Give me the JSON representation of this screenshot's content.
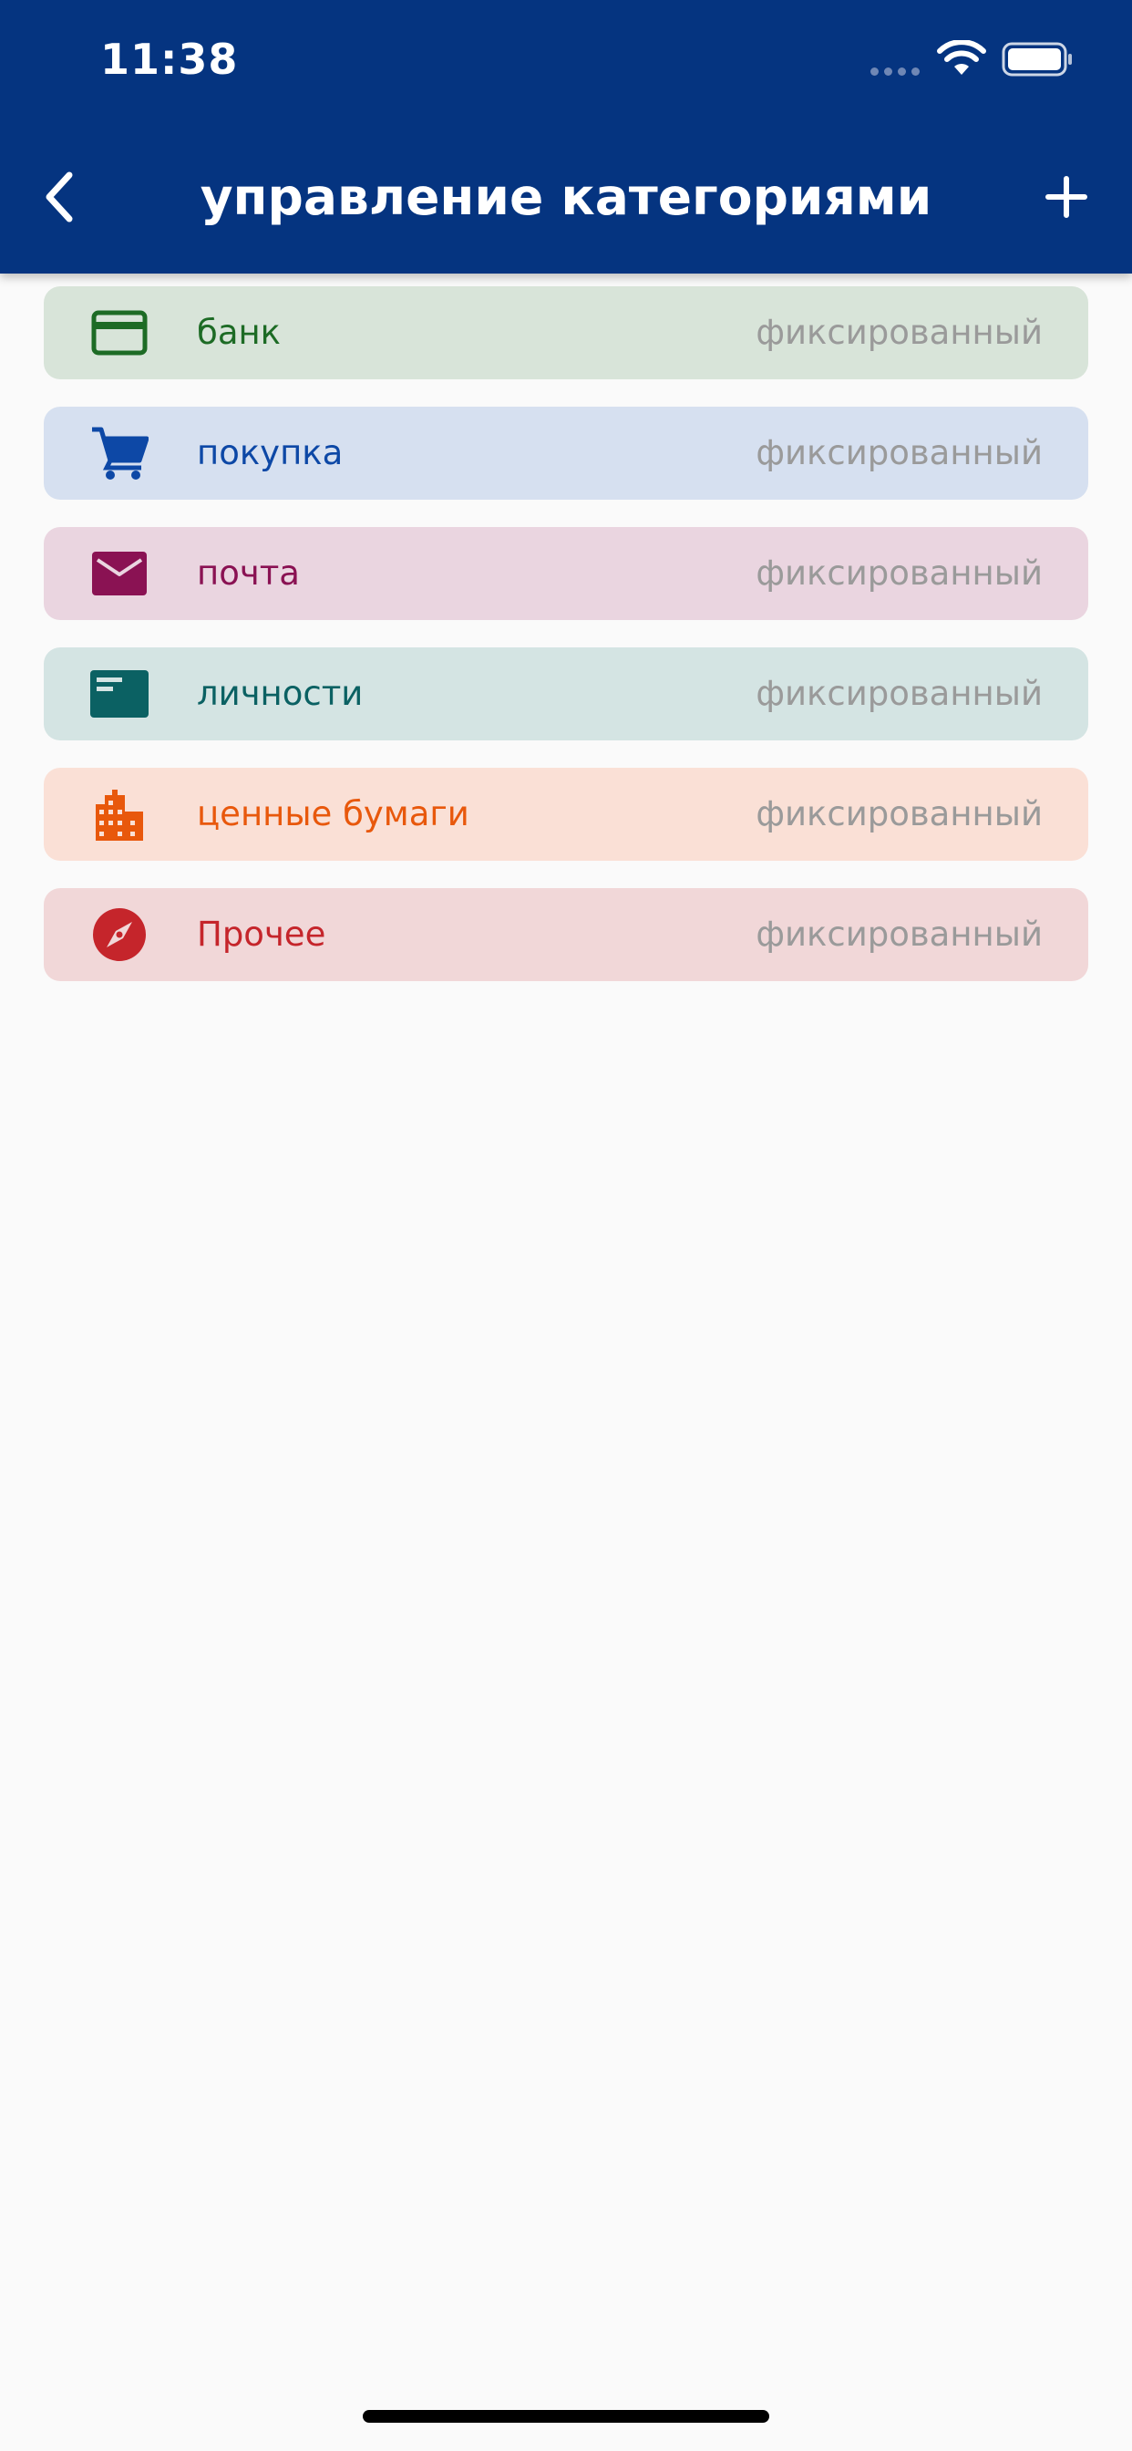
{
  "status_bar": {
    "time": "11:38"
  },
  "header": {
    "title": "управление категориями",
    "back_icon": "chevron-left-icon",
    "add_icon": "plus-icon"
  },
  "colors": {
    "header_bg": "#053480",
    "page_bg": "#fafafa",
    "status_text": "#9a9a9a"
  },
  "categories": [
    {
      "label": "банк",
      "status": "фиксированный",
      "icon": "credit-card-icon",
      "color": "#1d6b25",
      "bg": "#d8e4d9"
    },
    {
      "label": "покупка",
      "status": "фиксированный",
      "icon": "shopping-cart-icon",
      "color": "#0d48a6",
      "bg": "#d6e0f0"
    },
    {
      "label": "почта",
      "status": "фиксированный",
      "icon": "mail-icon",
      "color": "#8a1253",
      "bg": "#ead5e0"
    },
    {
      "label": "личности",
      "status": "фиксированный",
      "icon": "id-card-icon",
      "color": "#0b6163",
      "bg": "#d4e4e3"
    },
    {
      "label": "ценные бумаги",
      "status": "фиксированный",
      "icon": "building-icon",
      "color": "#e8580c",
      "bg": "#fae0d6"
    },
    {
      "label": "Прочее",
      "status": "фиксированный",
      "icon": "compass-icon",
      "color": "#c5252b",
      "bg": "#f1d7d8"
    }
  ]
}
